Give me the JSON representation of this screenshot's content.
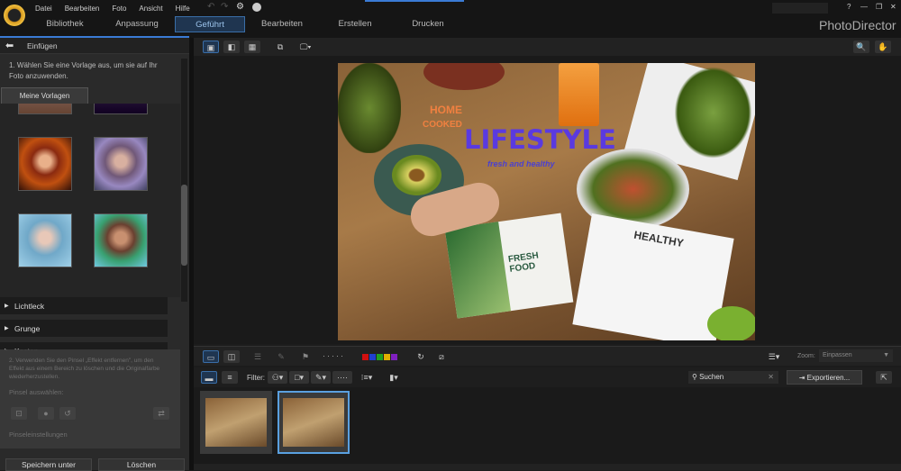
{
  "app": {
    "title": "PhotoDirector",
    "window_controls": [
      "?",
      "—",
      "❐",
      "✕"
    ]
  },
  "menu": [
    "Datei",
    "Bearbeiten",
    "Foto",
    "Ansicht",
    "Hilfe"
  ],
  "tabs": [
    {
      "label": "Bibliothek"
    },
    {
      "label": "Anpassung"
    },
    {
      "label": "Geführt",
      "active": true
    },
    {
      "label": "Bearbeiten"
    },
    {
      "label": "Erstellen"
    },
    {
      "label": "Drucken"
    }
  ],
  "left": {
    "header": "Einfügen",
    "step1": "1. Wählen Sie eine Vorlage aus, um sie auf Ihr Foto anzuwenden.",
    "templates_tab": "Meine Vorlagen",
    "sections": [
      "Lichtleck",
      "Grunge",
      "Kosten"
    ],
    "step2": "2. Verwenden Sie den Pinsel „Effekt entfernen\", um den Effekt aus einem Bereich zu löschen und die Originalfarbe wiederherzustellen.",
    "brush_label": "Pinsel auswählen:",
    "brush_settings": "Pinseleinstellungen",
    "save_as": "Speichern unter",
    "delete": "Löschen"
  },
  "photo": {
    "home": "HOME",
    "cooked": "COOKED",
    "title": "LIFESTYLE",
    "subtitle": "fresh and healthy",
    "book": "FRESH FOOD",
    "paper": "HEALTHY"
  },
  "toolbar": {
    "filter_label": "Filter:",
    "zoom_label": "Zoom:",
    "zoom_value": "Einpassen",
    "search_placeholder": "Suchen",
    "export": "Exportieren...",
    "colors": [
      "#d01010",
      "#2040d0",
      "#20a020",
      "#e0b000",
      "#8020c0"
    ]
  },
  "filmstrip": {
    "selected_index": 1
  }
}
